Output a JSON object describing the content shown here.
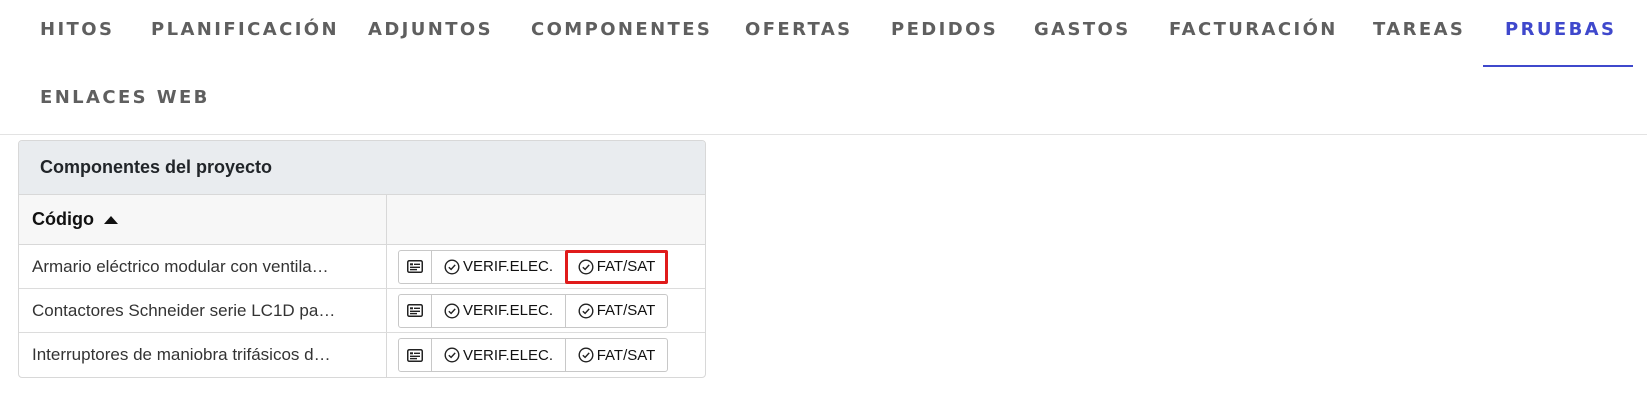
{
  "tabs": {
    "items": [
      {
        "label": "HITOS"
      },
      {
        "label": "PLANIFICACIÓN"
      },
      {
        "label": "ADJUNTOS"
      },
      {
        "label": "COMPONENTES"
      },
      {
        "label": "OFERTAS"
      },
      {
        "label": "PEDIDOS"
      },
      {
        "label": "GASTOS"
      },
      {
        "label": "FACTURACIÓN"
      },
      {
        "label": "TAREAS"
      },
      {
        "label": "PRUEBAS",
        "active": true
      },
      {
        "label": "ENLACES WEB"
      }
    ],
    "active_color": "#3f48cc"
  },
  "card": {
    "title": "Componentes del proyecto",
    "columns": {
      "code": "Código",
      "actions": ""
    },
    "rows": [
      {
        "code": "Armario eléctrico modular con ventila…",
        "verif": "VERIF.ELEC.",
        "fat": "FAT/SAT"
      },
      {
        "code": "Contactores Schneider serie LC1D pa…",
        "verif": "VERIF.ELEC.",
        "fat": "FAT/SAT"
      },
      {
        "code": "Interruptores de maniobra trifásicos d…",
        "verif": "VERIF.ELEC.",
        "fat": "FAT/SAT"
      }
    ],
    "icons": {
      "detail": "id-card-icon",
      "check": "check-circle-icon",
      "sort": "sort-asc-icon"
    },
    "highlight_color": "#e01b1b"
  }
}
